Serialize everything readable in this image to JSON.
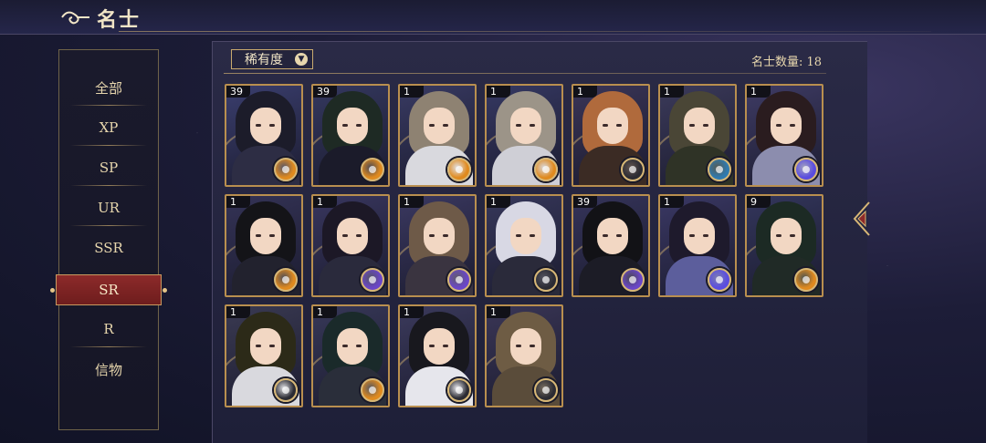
{
  "header": {
    "title": "名士"
  },
  "sidebar": {
    "items": [
      {
        "label": "全部"
      },
      {
        "label": "XP"
      },
      {
        "label": "SP"
      },
      {
        "label": "UR"
      },
      {
        "label": "SSR"
      },
      {
        "label": "SR",
        "active": true
      },
      {
        "label": "R"
      },
      {
        "label": "信物"
      }
    ]
  },
  "filter": {
    "label": "稀有度"
  },
  "count": {
    "text": "名士数量: 18"
  },
  "cards": [
    {
      "level": "39",
      "hair": "#1c1c2a",
      "body": "#2d2d44",
      "emblem": "#e08a1e",
      "bg": "#3a3e6e"
    },
    {
      "level": "39",
      "hair": "#1e2a24",
      "body": "#1b1b2a",
      "emblem": "#e08a1e",
      "bg": "#34385f"
    },
    {
      "level": "1",
      "hair": "#8e8272",
      "body": "#d9d9de",
      "emblem": "#e08a1e",
      "bg": "#383a62"
    },
    {
      "level": "1",
      "hair": "#9c9488",
      "body": "#cfcfd6",
      "emblem": "#e08a1e",
      "bg": "#353862"
    },
    {
      "level": "1",
      "hair": "#b06a3c",
      "body": "#3b2b24",
      "emblem": "#2b2b33",
      "bg": "#3a3557"
    },
    {
      "level": "1",
      "hair": "#4a4636",
      "body": "#2f3326",
      "emblem": "#2f7ab0",
      "bg": "#3b3a5a"
    },
    {
      "level": "1",
      "hair": "#2a1c1f",
      "body": "#8c8dae",
      "emblem": "#5a4ce0",
      "bg": "#3e3b64"
    },
    {
      "level": "1",
      "hair": "#141418",
      "body": "#22222e",
      "emblem": "#e08a1e",
      "bg": "#343356"
    },
    {
      "level": "1",
      "hair": "#1c1826",
      "body": "#2a2a3c",
      "emblem": "#6a46c8",
      "bg": "#38365e"
    },
    {
      "level": "1",
      "hair": "#6e5a48",
      "body": "#3a3440",
      "emblem": "#6a46c8",
      "bg": "#3a3860"
    },
    {
      "level": "1",
      "hair": "#d8d8e4",
      "body": "#2a2a3a",
      "emblem": "#2b2b33",
      "bg": "#36375a"
    },
    {
      "level": "39",
      "hair": "#121216",
      "body": "#1c1c26",
      "emblem": "#6a46c8",
      "bg": "#35345a"
    },
    {
      "level": "1",
      "hair": "#1e1a2c",
      "body": "#5c5e9c",
      "emblem": "#5a4ce0",
      "bg": "#3a3864"
    },
    {
      "level": "9",
      "hair": "#1c2a24",
      "body": "#202a26",
      "emblem": "#e08a1e",
      "bg": "#33365c"
    },
    {
      "level": "1",
      "hair": "#2c2a18",
      "body": "#d9d9de",
      "emblem": "#2b2b33",
      "bg": "#3a3a52"
    },
    {
      "level": "1",
      "hair": "#1a2a2a",
      "body": "#2a2e3a",
      "emblem": "#e08a1e",
      "bg": "#373858"
    },
    {
      "level": "1",
      "hair": "#18181e",
      "body": "#e6e6ec",
      "emblem": "#2b2b33",
      "bg": "#3b3a5c"
    },
    {
      "level": "1",
      "hair": "#6e5c44",
      "body": "#5a4c3a",
      "emblem": "#2b2b33",
      "bg": "#3a3656"
    }
  ]
}
